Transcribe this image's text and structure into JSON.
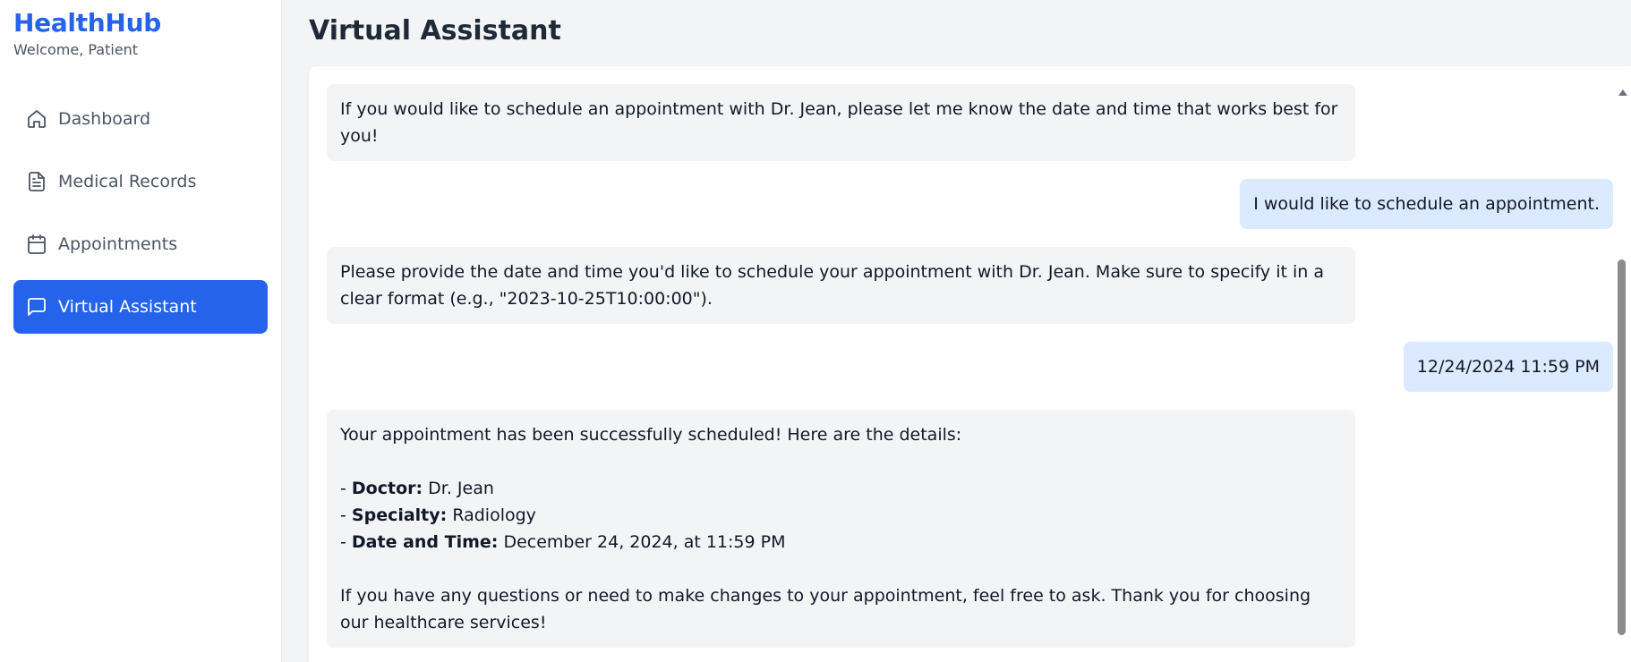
{
  "sidebar": {
    "brand": "HealthHub",
    "welcome": "Welcome, Patient",
    "items": [
      {
        "label": "Dashboard",
        "icon": "home-icon"
      },
      {
        "label": "Medical Records",
        "icon": "document-icon"
      },
      {
        "label": "Appointments",
        "icon": "calendar-icon"
      },
      {
        "label": "Virtual Assistant",
        "icon": "chat-icon",
        "active": true
      }
    ]
  },
  "main": {
    "title": "Virtual Assistant"
  },
  "chat": {
    "messages": [
      {
        "role": "assistant",
        "text": "If you would like to schedule an appointment with Dr. Jean, please let me know the date and time that works best for you!"
      },
      {
        "role": "user",
        "text": "I would like to schedule an appointment."
      },
      {
        "role": "assistant",
        "text": "Please provide the date and time you'd like to schedule your appointment with Dr. Jean. Make sure to specify it in a clear format (e.g., \"2023-10-25T10:00:00\")."
      },
      {
        "role": "user",
        "text": "12/24/2024 11:59 PM"
      },
      {
        "role": "assistant",
        "intro": "Your appointment has been successfully scheduled! Here are the details:",
        "details": [
          {
            "label": "Doctor:",
            "value": "Dr. Jean"
          },
          {
            "label": "Specialty:",
            "value": "Radiology"
          },
          {
            "label": "Date and Time:",
            "value": "December 24, 2024, at 11:59 PM"
          }
        ],
        "closing": "If you have any questions or need to make changes to your appointment, feel free to ask. Thank you for choosing our healthcare services!"
      }
    ]
  },
  "colors": {
    "accent": "#2563eb",
    "user_bubble": "#dbeafe",
    "assistant_bubble": "#f3f4f6"
  }
}
